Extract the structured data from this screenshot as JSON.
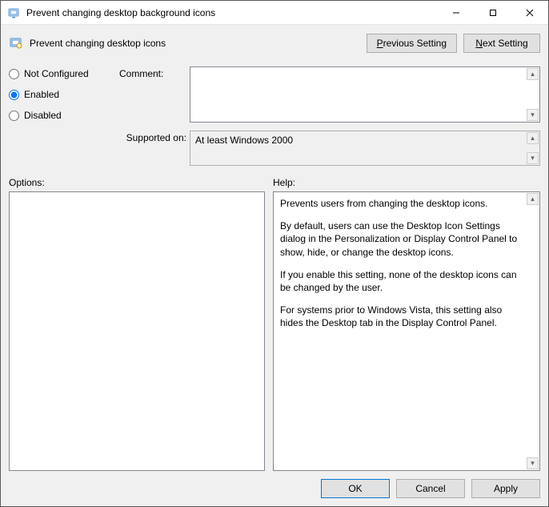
{
  "window": {
    "title": "Prevent changing desktop background icons"
  },
  "header": {
    "policy_title": "Prevent changing desktop icons",
    "prev_pre": "P",
    "prev_rest": "revious Setting",
    "next_pre": "N",
    "next_rest": "ext Setting"
  },
  "state": {
    "not_configured_label": "Not Configured",
    "enabled_label": "Enabled",
    "disabled_label": "Disabled",
    "selected": "enabled"
  },
  "fields": {
    "comment_label": "Comment:",
    "comment_value": "",
    "supported_label": "Supported on:",
    "supported_value": "At least Windows 2000"
  },
  "panes": {
    "options_label": "Options:",
    "help_label": "Help:",
    "help_paragraphs": [
      "Prevents users from changing the desktop icons.",
      "By default, users can use the Desktop Icon Settings dialog in the Personalization or Display Control Panel to show, hide, or change the desktop icons.",
      "If you enable this setting, none of the desktop icons can be changed by the user.",
      "For systems prior to Windows Vista, this setting also hides the Desktop tab in the Display Control Panel."
    ]
  },
  "buttons": {
    "ok": "OK",
    "cancel": "Cancel",
    "apply": "Apply"
  }
}
